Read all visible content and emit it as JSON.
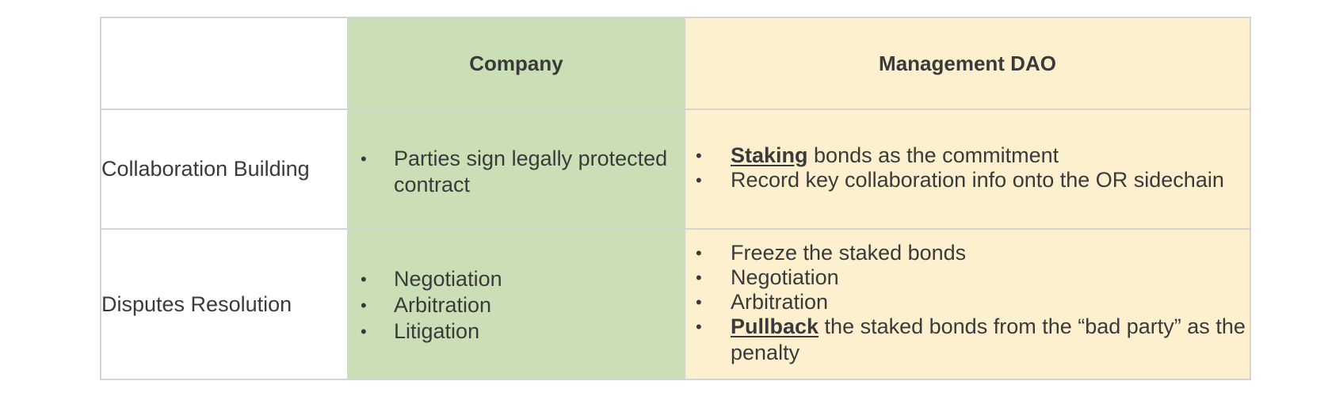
{
  "header": {
    "col_company": "Company",
    "col_dao": "Management DAO"
  },
  "rows": [
    {
      "label": "Collaboration Building",
      "company": [
        "Parties sign legally protected contract"
      ],
      "dao": [
        {
          "kw": "Staking",
          "rest": " bonds as the commitment"
        },
        {
          "kw": "",
          "rest": "Record key collaboration info onto the OR sidechain"
        }
      ]
    },
    {
      "label": "Disputes Resolution",
      "company": [
        "Negotiation",
        "Arbitration",
        "Litigation"
      ],
      "dao": [
        {
          "kw": "",
          "rest": "Freeze the staked bonds"
        },
        {
          "kw": "",
          "rest": "Negotiation"
        },
        {
          "kw": "",
          "rest": "Arbitration"
        },
        {
          "kw": "Pullback",
          "rest": " the staked bonds from the “bad party” as the penalty"
        }
      ]
    }
  ],
  "bullet": "•",
  "colors": {
    "company_bg": "#cbdfb7",
    "dao_bg": "#fcf0cf",
    "border": "#d4d4d4",
    "text": "#3a3a3a"
  }
}
